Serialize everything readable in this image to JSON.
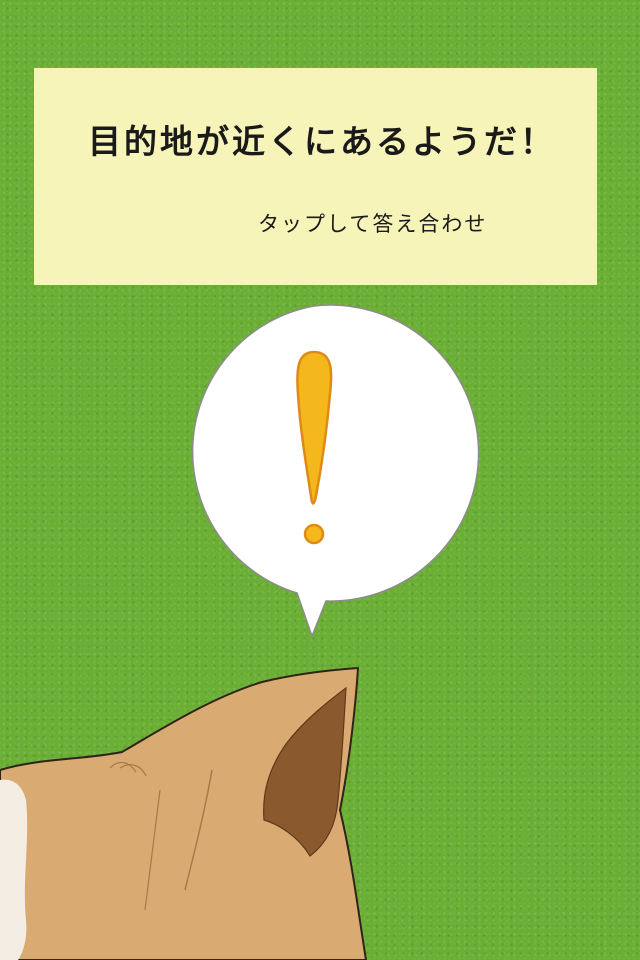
{
  "message": {
    "title": "目的地が近くにあるようだ！",
    "tap_hint": "タップして答え合わせ"
  },
  "speech_bubble": {
    "icon": "exclamation-icon",
    "accent_color": "#f5b81c",
    "outline_color": "#e08a16"
  },
  "colors": {
    "background": "#6aae34",
    "panel": "#f6f4b8",
    "text": "#1a1a1a",
    "cat_fur": "#d9aa72",
    "cat_ear_inner": "#8a5a2e"
  }
}
